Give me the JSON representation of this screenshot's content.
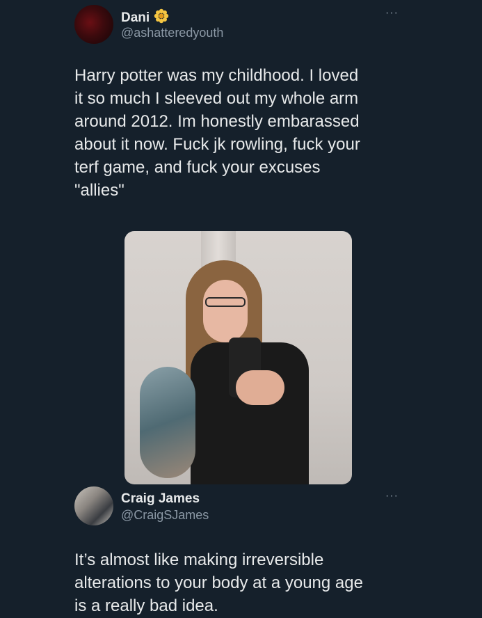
{
  "tweets": [
    {
      "name": "Dani",
      "badge_icon": "flower-icon",
      "handle": "@ashatteredyouth",
      "text": "Harry potter was my childhood. I loved\nit so much I sleeved out my whole arm\naround 2012. Im honestly embarassed\nabout it now. Fuck jk rowling, fuck your\nterf game, and fuck your excuses\n\"allies\"",
      "more": "···"
    },
    {
      "name": "Craig James",
      "handle": "@CraigSJames",
      "text": "It’s almost like making irreversible\nalterations to your body at a young age\nis a really bad idea.",
      "more": "···"
    }
  ],
  "colors": {
    "background": "#15202b",
    "primary_text": "#e7e9ea",
    "secondary_text": "#8b98a5",
    "badge": "#f4c542"
  }
}
